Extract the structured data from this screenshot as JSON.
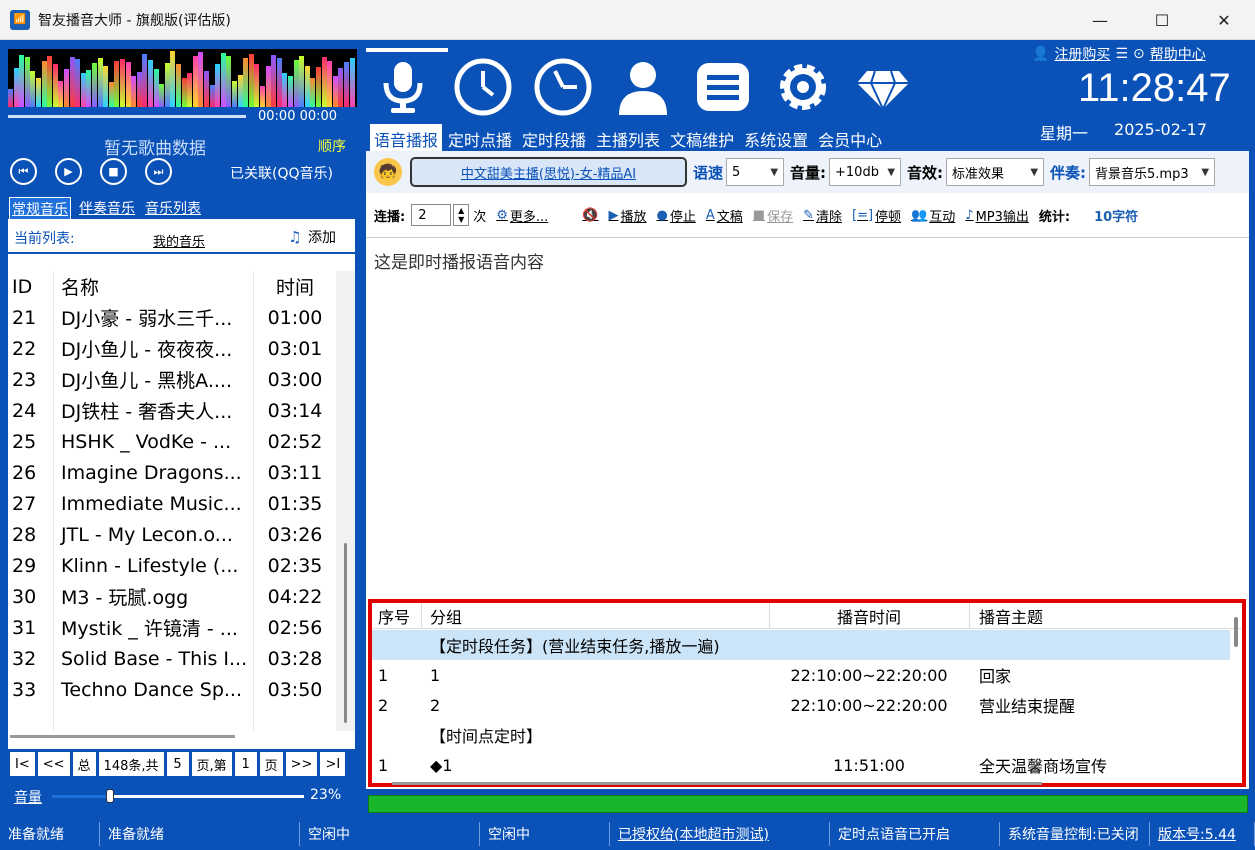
{
  "window": {
    "title": "智友播音大师 - 旗舰版(评估版)",
    "minimize": "—",
    "maximize": "☐",
    "close": "✕"
  },
  "player": {
    "time_display": "00:00  00:00",
    "no_song": "暂无歌曲数据",
    "play_order": "顺序",
    "qq_status": "已关联(QQ音乐)",
    "controls": [
      "prev",
      "play",
      "stop",
      "next"
    ]
  },
  "music_tabs": [
    "常规音乐",
    "伴奏音乐",
    "音乐列表"
  ],
  "playlist": {
    "current_label": "当前列表:",
    "current_name": "我的音乐",
    "add_label": "添加",
    "columns": [
      "ID",
      "名称",
      "时间"
    ],
    "rows": [
      {
        "id": "21",
        "name": "DJ小豪 - 弱水三千...",
        "time": "01:00"
      },
      {
        "id": "22",
        "name": "DJ小鱼儿 - 夜夜夜...",
        "time": "03:01"
      },
      {
        "id": "23",
        "name": "DJ小鱼儿 - 黑桃A....",
        "time": "03:00"
      },
      {
        "id": "24",
        "name": "DJ铁柱 - 奢香夫人...",
        "time": "03:14"
      },
      {
        "id": "25",
        "name": "HSHK _ VodKe - ...",
        "time": "02:52"
      },
      {
        "id": "26",
        "name": "Imagine Dragons...",
        "time": "03:11"
      },
      {
        "id": "27",
        "name": "Immediate Music...",
        "time": "01:35"
      },
      {
        "id": "28",
        "name": "JTL - My Lecon.o...",
        "time": "03:26"
      },
      {
        "id": "29",
        "name": "Klinn - Lifestyle (...",
        "time": "02:35"
      },
      {
        "id": "30",
        "name": "M3 - 玩腻.ogg",
        "time": "04:22"
      },
      {
        "id": "31",
        "name": "Mystik _ 许镜清 - ...",
        "time": "02:56"
      },
      {
        "id": "32",
        "name": "Solid Base - This I...",
        "time": "03:28"
      },
      {
        "id": "33",
        "name": "Techno Dance Sp...",
        "time": "03:50"
      }
    ]
  },
  "pager": {
    "first": "I<",
    "prev": "<<",
    "total_label": "总",
    "total_count": "148条,共",
    "pages": "5",
    "page_label": "页,第",
    "current_page": "1",
    "page_suffix": "页",
    "next": ">>",
    "last": ">I"
  },
  "volume": {
    "label": "音量",
    "percent_text": "23%",
    "level": 0.23
  },
  "header": {
    "register": "注册购买",
    "help": "帮助中心",
    "clock": "11:28:47",
    "weekday": "星期一",
    "date": "2025-02-17"
  },
  "nav_tabs": [
    "语音播报",
    "定时点播",
    "定时段播",
    "主播列表",
    "文稿维护",
    "系统设置",
    "会员中心"
  ],
  "nav_icons": [
    "microphone-icon",
    "clock-icon",
    "clock-range-icon",
    "person-icon",
    "document-icon",
    "gear-icon",
    "diamond-icon"
  ],
  "voice_bar": {
    "voice_name": "中文甜美主播(思悦)-女-精品AI",
    "speed_label": "语速",
    "speed_value": "5",
    "volume_label": "音量:",
    "volume_value": "+10db",
    "effect_label": "音效:",
    "effect_value": "标准效果",
    "accomp_label": "伴奏:",
    "accomp_value": "背景音乐5.mp3"
  },
  "toolbar": {
    "repeat_label": "连播:",
    "repeat_value": "2",
    "times_label": "次",
    "more": "更多...",
    "play": "播放",
    "stop": "停止",
    "doc": "文稿",
    "save": "保存",
    "clear": "清除",
    "pause": "停顿",
    "interact": "互动",
    "mp3": "MP3输出",
    "stat_label": "统计:",
    "char_count": "10字符"
  },
  "broadcast_text": "这是即时播报语音内容",
  "tasks": {
    "columns": [
      "序号",
      "分组",
      "播音时间",
      "播音主题"
    ],
    "rows": [
      {
        "seq": "",
        "group": "【定时段任务】(营业结束任务,播放一遍)",
        "time": "",
        "topic": "",
        "highlight": true
      },
      {
        "seq": "1",
        "group": "1",
        "time": "22:10:00~22:20:00",
        "topic": "回家",
        "highlight": false
      },
      {
        "seq": "2",
        "group": "2",
        "time": "22:10:00~22:20:00",
        "topic": "营业结束提醒",
        "highlight": false
      },
      {
        "seq": "",
        "group": "【时间点定时】",
        "time": "",
        "topic": "",
        "highlight": false
      },
      {
        "seq": "1",
        "group": "◆1",
        "time": "11:51:00",
        "topic": "全天温馨商场宣传",
        "highlight": false
      }
    ]
  },
  "status_bar": [
    {
      "text": "准备就绪",
      "underline": false
    },
    {
      "text": "准备就绪",
      "underline": false
    },
    {
      "text": "空闲中",
      "underline": false
    },
    {
      "text": "空闲中",
      "underline": false
    },
    {
      "text": "已授权给(本地超市测试)",
      "underline": true
    },
    {
      "text": "定时点语音已开启",
      "underline": false
    },
    {
      "text": "系统音量控制:已关闭",
      "underline": false
    },
    {
      "text": "版本号:5.44",
      "underline": true
    }
  ],
  "colors": {
    "primary": "#0a52b8",
    "accent_yellow": "#f6ff3a",
    "highlight": "#cce4f7",
    "alert_red": "#e00000",
    "green": "#19b52a"
  }
}
